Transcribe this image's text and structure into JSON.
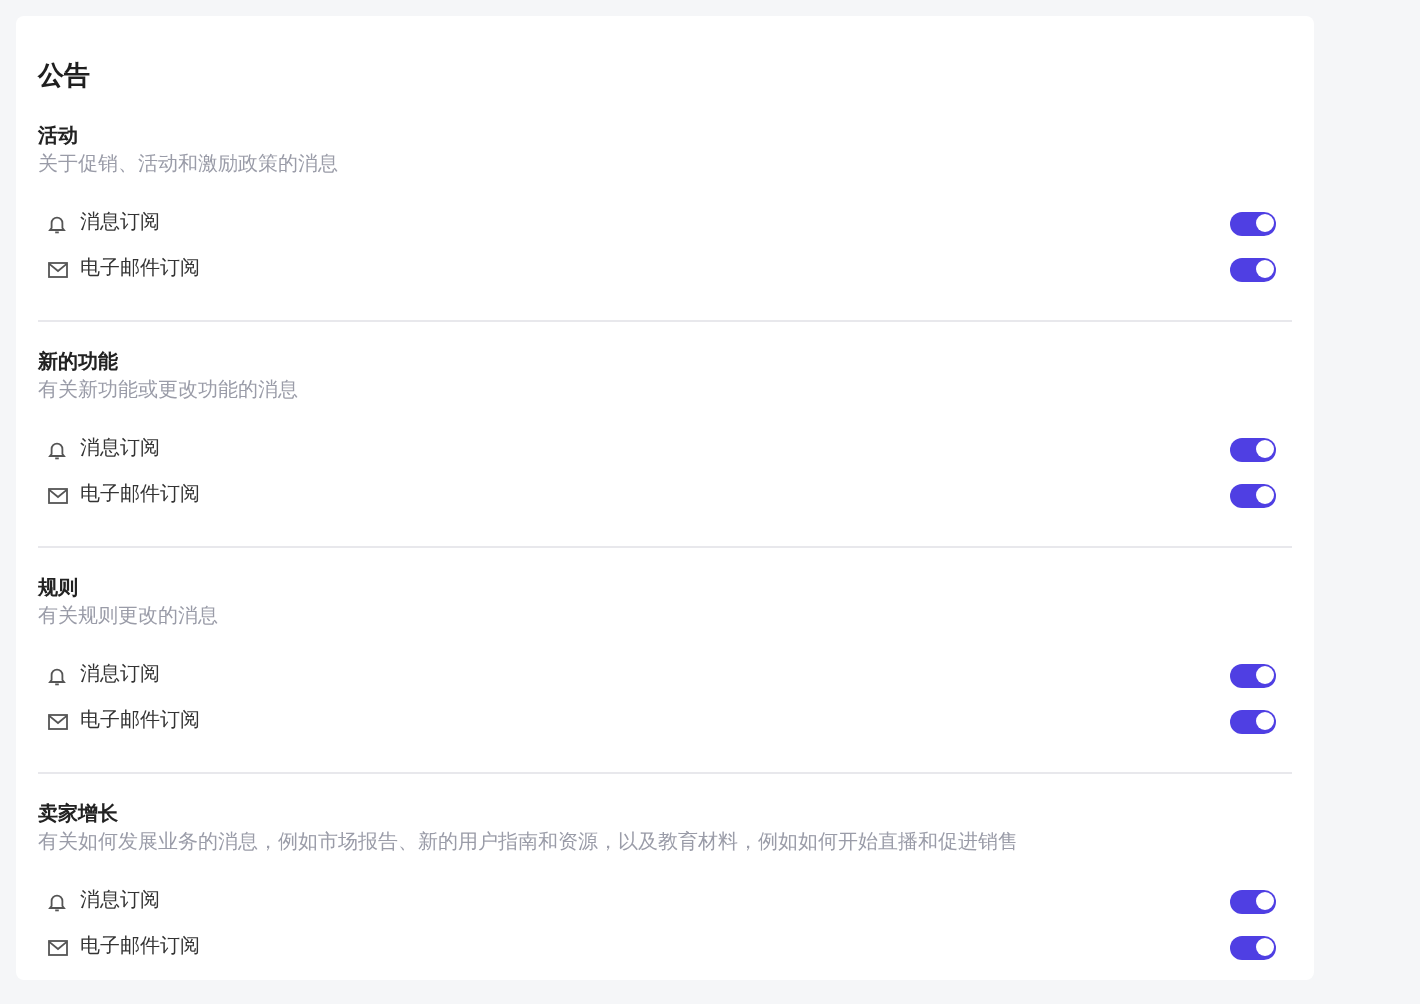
{
  "title": "公告",
  "sections": [
    {
      "title": "活动",
      "description": "关于促销、活动和激励政策的消息",
      "channels": [
        {
          "kind": "push",
          "label": "消息订阅",
          "on": true
        },
        {
          "kind": "email",
          "label": "电子邮件订阅",
          "on": true
        }
      ]
    },
    {
      "title": "新的功能",
      "description": "有关新功能或更改功能的消息",
      "channels": [
        {
          "kind": "push",
          "label": "消息订阅",
          "on": true
        },
        {
          "kind": "email",
          "label": "电子邮件订阅",
          "on": true
        }
      ]
    },
    {
      "title": "规则",
      "description": "有关规则更改的消息",
      "channels": [
        {
          "kind": "push",
          "label": "消息订阅",
          "on": true
        },
        {
          "kind": "email",
          "label": "电子邮件订阅",
          "on": true
        }
      ]
    },
    {
      "title": "卖家增长",
      "description": "有关如何发展业务的消息，例如市场报告、新的用户指南和资源，以及教育材料，例如如何开始直播和促进销售",
      "channels": [
        {
          "kind": "push",
          "label": "消息订阅",
          "on": true
        },
        {
          "kind": "email",
          "label": "电子邮件订阅",
          "on": true
        }
      ]
    }
  ]
}
